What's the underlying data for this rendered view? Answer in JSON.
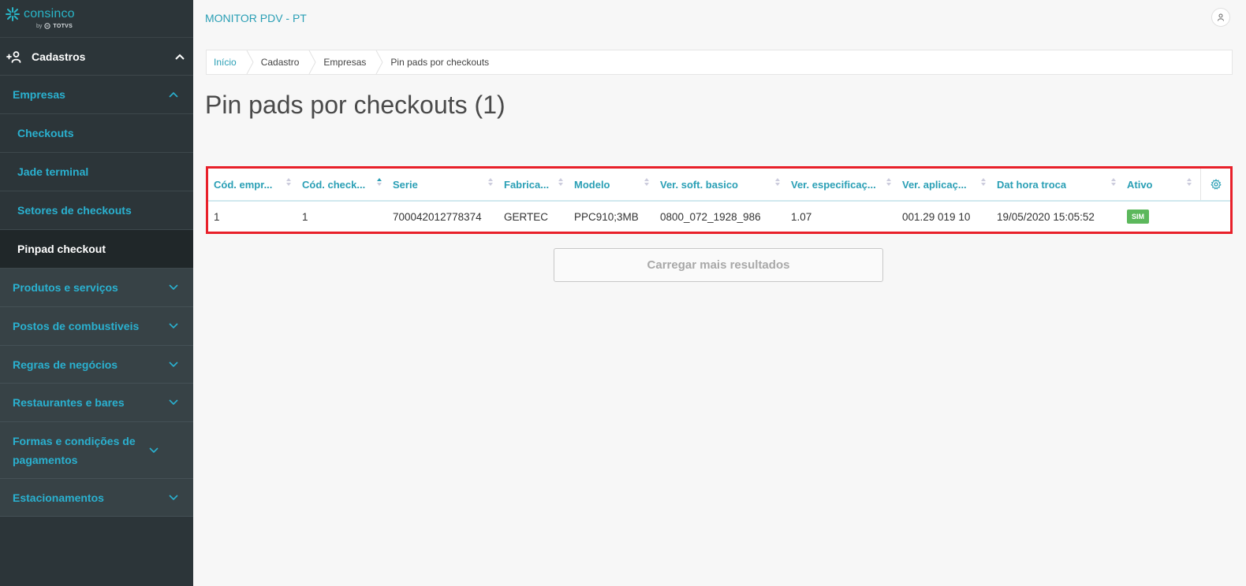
{
  "brand": {
    "name": "consinco",
    "by": "by",
    "parent": "TOTVS"
  },
  "app": {
    "title": "MONITOR PDV - PT"
  },
  "sidebar": {
    "section": "Cadastros",
    "group_open": "Empresas",
    "subitems": [
      "Checkouts",
      "Jade terminal",
      "Setores de checkouts",
      "Pinpad checkout"
    ],
    "active_subitem": "Pinpad checkout",
    "groups": [
      "Produtos e serviços",
      "Postos de combustiveis",
      "Regras de negócios",
      "Restaurantes e bares",
      "Formas e condições de pagamentos",
      "Estacionamentos"
    ]
  },
  "breadcrumb": [
    "Início",
    "Cadastro",
    "Empresas",
    "Pin pads por checkouts"
  ],
  "page": {
    "title": "Pin pads por checkouts (1)"
  },
  "table": {
    "columns": [
      "Cód. empr...",
      "Cód. check...",
      "Serie",
      "Fabrica...",
      "Modelo",
      "Ver. soft. basico",
      "Ver. especificaç...",
      "Ver. aplicaç...",
      "Dat hora troca",
      "Ativo"
    ],
    "sorted_column": "Cód. check...",
    "rows": [
      [
        "1",
        "1",
        "700042012778374",
        "GERTEC",
        "PPC910;3MB",
        "0800_072_1928_986",
        "1.07",
        "001.29 019 10",
        "19/05/2020 15:05:52",
        "SIM"
      ]
    ],
    "badge_color": "#5cb85c"
  },
  "load_more": "Carregar mais resultados",
  "colors": {
    "accent": "#2a9fb5",
    "sidebar_bg": "#2c3539",
    "highlight": "#e8202a"
  }
}
